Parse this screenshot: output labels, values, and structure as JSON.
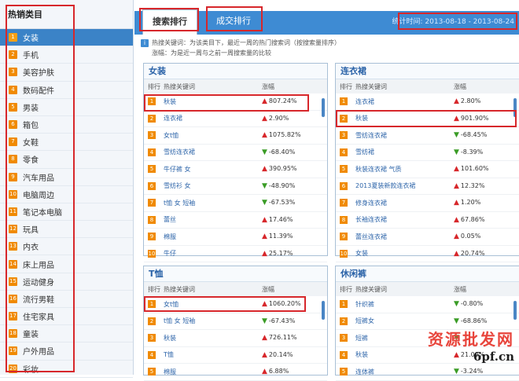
{
  "sidebar": {
    "title": "热销类目",
    "items": [
      {
        "num": "1",
        "label": "女装"
      },
      {
        "num": "2",
        "label": "手机"
      },
      {
        "num": "3",
        "label": "美容护肤"
      },
      {
        "num": "4",
        "label": "数码配件"
      },
      {
        "num": "5",
        "label": "男装"
      },
      {
        "num": "6",
        "label": "箱包"
      },
      {
        "num": "7",
        "label": "女鞋"
      },
      {
        "num": "8",
        "label": "零食"
      },
      {
        "num": "9",
        "label": "汽车用品"
      },
      {
        "num": "10",
        "label": "电脑周边"
      },
      {
        "num": "11",
        "label": "笔记本电脑"
      },
      {
        "num": "12",
        "label": "玩具"
      },
      {
        "num": "13",
        "label": "内衣"
      },
      {
        "num": "14",
        "label": "床上用品"
      },
      {
        "num": "15",
        "label": "运动健身"
      },
      {
        "num": "16",
        "label": "流行男鞋"
      },
      {
        "num": "17",
        "label": "住宅家具"
      },
      {
        "num": "18",
        "label": "童装"
      },
      {
        "num": "19",
        "label": "户外用品"
      },
      {
        "num": "20",
        "label": "彩妆"
      }
    ]
  },
  "tabs": [
    {
      "label": "搜索排行"
    },
    {
      "label": "成交排行"
    }
  ],
  "stat_time": "统计时间: 2013-08-18 - 2013-08-24",
  "notes": {
    "line1": "热搜关键词：为该类目下，最近一周的热门搜索词（按搜索量排序）",
    "line2": "涨幅：为是近一周与之前一周搜索量的比较"
  },
  "columns": {
    "rank": "排行",
    "keyword": "热搜关键词",
    "change": "涨幅"
  },
  "panels": [
    {
      "title": "女装",
      "rows": [
        {
          "rank": "1",
          "keyword": "秋装",
          "dir": "up",
          "change": "807.24%"
        },
        {
          "rank": "2",
          "keyword": "连衣裙",
          "dir": "up",
          "change": "2.90%"
        },
        {
          "rank": "3",
          "keyword": "女t恤",
          "dir": "up",
          "change": "1075.82%"
        },
        {
          "rank": "4",
          "keyword": "雪纺连衣裙",
          "dir": "down",
          "change": "-68.40%"
        },
        {
          "rank": "5",
          "keyword": "牛仔裤 女",
          "dir": "up",
          "change": "390.95%"
        },
        {
          "rank": "6",
          "keyword": "雪纺衫 女",
          "dir": "down",
          "change": "-48.90%"
        },
        {
          "rank": "7",
          "keyword": "t恤 女 短袖",
          "dir": "down",
          "change": "-67.53%"
        },
        {
          "rank": "8",
          "keyword": "蕾丝",
          "dir": "up",
          "change": "17.46%"
        },
        {
          "rank": "9",
          "keyword": "棉服",
          "dir": "up",
          "change": "11.39%"
        },
        {
          "rank": "10",
          "keyword": "牛仔",
          "dir": "up",
          "change": "25.17%"
        }
      ]
    },
    {
      "title": "连衣裙",
      "rows": [
        {
          "rank": "1",
          "keyword": "连衣裙",
          "dir": "up",
          "change": "2.80%"
        },
        {
          "rank": "2",
          "keyword": "秋装",
          "dir": "up",
          "change": "901.90%"
        },
        {
          "rank": "3",
          "keyword": "雪纺连衣裙",
          "dir": "down",
          "change": "-68.45%"
        },
        {
          "rank": "4",
          "keyword": "雪纺裙",
          "dir": "down",
          "change": "-8.39%"
        },
        {
          "rank": "5",
          "keyword": "秋装连衣裙 气质",
          "dir": "up",
          "change": "101.60%"
        },
        {
          "rank": "6",
          "keyword": "2013夏装新款连衣裙",
          "dir": "up",
          "change": "12.32%"
        },
        {
          "rank": "7",
          "keyword": "修身连衣裙",
          "dir": "up",
          "change": "1.20%"
        },
        {
          "rank": "8",
          "keyword": "长袖连衣裙",
          "dir": "up",
          "change": "67.86%"
        },
        {
          "rank": "9",
          "keyword": "蕾丝连衣裙",
          "dir": "up",
          "change": "0.05%"
        },
        {
          "rank": "10",
          "keyword": "女装",
          "dir": "up",
          "change": "20.74%"
        }
      ]
    },
    {
      "title": "T恤",
      "rows": [
        {
          "rank": "1",
          "keyword": "女t恤",
          "dir": "up",
          "change": "1060.20%"
        },
        {
          "rank": "2",
          "keyword": "t恤 女 短袖",
          "dir": "down",
          "change": "-67.43%"
        },
        {
          "rank": "3",
          "keyword": "秋装",
          "dir": "up",
          "change": "726.11%"
        },
        {
          "rank": "4",
          "keyword": "T恤",
          "dir": "up",
          "change": "20.14%"
        },
        {
          "rank": "5",
          "keyword": "棉服",
          "dir": "up",
          "change": "6.88%"
        }
      ]
    },
    {
      "title": "休闲裤",
      "rows": [
        {
          "rank": "1",
          "keyword": "针织裤",
          "dir": "down",
          "change": "-0.80%"
        },
        {
          "rank": "2",
          "keyword": "短裤女",
          "dir": "down",
          "change": "-68.86%"
        },
        {
          "rank": "3",
          "keyword": "短裤",
          "dir": "down",
          "change": ""
        },
        {
          "rank": "4",
          "keyword": "秋装",
          "dir": "up",
          "change": "21.09%"
        },
        {
          "rank": "5",
          "keyword": "连体裤",
          "dir": "down",
          "change": "-3.24%"
        }
      ]
    }
  ],
  "watermark": {
    "line1": "资源批发网",
    "line2": "6pf.cn"
  }
}
